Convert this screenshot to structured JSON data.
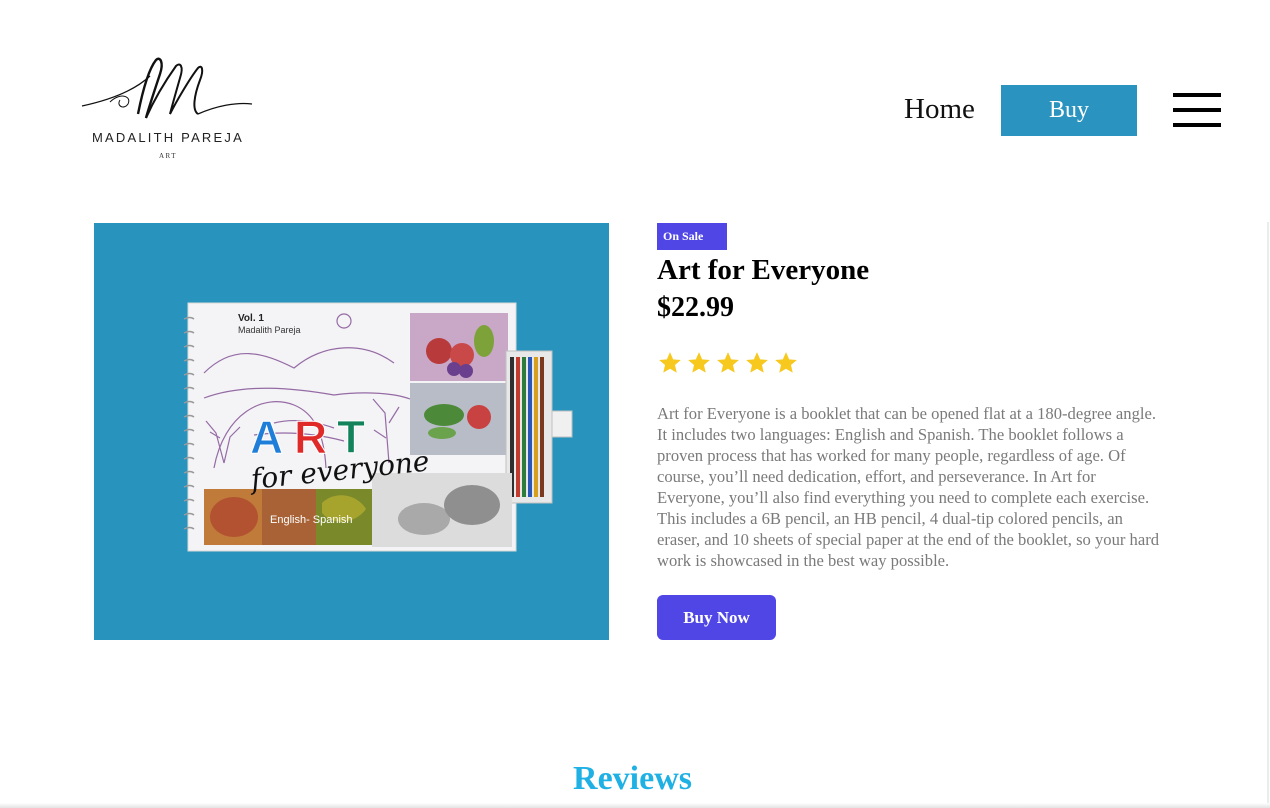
{
  "header": {
    "logo": {
      "name": "MADALITH PAREJA",
      "sub": "ART"
    },
    "nav": {
      "home_label": "Home",
      "buy_label": "Buy"
    }
  },
  "product": {
    "badge": "On Sale",
    "title": "Art for Everyone",
    "price": "$22.99",
    "rating": 5,
    "description": "Art for Everyone is a booklet that can be opened flat at a 180-degree angle. It includes two languages: English and Spanish. The booklet follows a proven process that has worked for many people, regardless of age. Of course, you’ll need dedication, effort, and perseverance. In Art for Everyone, you’ll also find everything you need to complete each exercise. This includes a 6B pencil, an HB pencil, 4 dual-tip colored pencils, an eraser, and 10 sheets of special paper at the end of the booklet, so your hard work is showcased in the best way possible.",
    "buy_now_label": "Buy Now",
    "image": {
      "vol": "Vol. 1",
      "author": "Madalith Pareja",
      "art_letters": [
        "A",
        "R",
        "T"
      ],
      "art_colors": [
        "#1f7fd8",
        "#e02a2a",
        "#12835a"
      ],
      "subtitle": "for everyone",
      "languages": "English- Spanish"
    }
  },
  "reviews": {
    "heading": "Reviews"
  },
  "colors": {
    "accent": "#4f46e5",
    "nav_buy": "#2a93bf",
    "image_bg": "#2893bd",
    "star": "#f7c81e",
    "reviews": "#1fb0e4"
  }
}
